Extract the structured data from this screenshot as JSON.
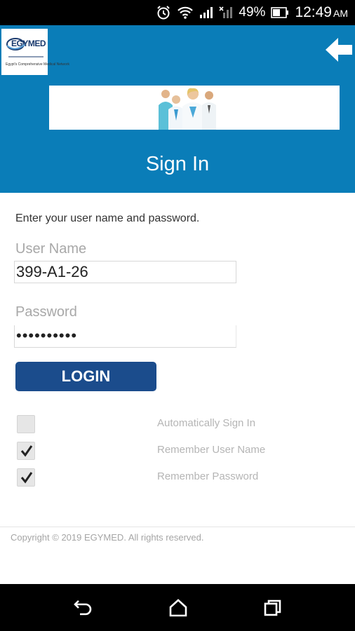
{
  "status_bar": {
    "battery_percent": "49%",
    "time": "12:49",
    "ampm": "AM"
  },
  "header": {
    "logo_text": "EGYMED",
    "logo_subtext": "Egypt's Comprehensive Medical Network",
    "title": "Sign In"
  },
  "form": {
    "instruction": "Enter your user name and password.",
    "username_label": "User Name",
    "username_value": "399-A1-26",
    "password_label": "Password",
    "password_value": "••••••••••",
    "login_label": "LOGIN"
  },
  "options": [
    {
      "label": "Automatically Sign In",
      "checked": false
    },
    {
      "label": "Remember User Name",
      "checked": true
    },
    {
      "label": "Remember Password",
      "checked": true
    }
  ],
  "footer": {
    "copyright": "Copyright © 2019 EGYMED. All rights reserved."
  },
  "colors": {
    "header_bg": "#0a7db8",
    "button_bg": "#1b4c8c"
  }
}
